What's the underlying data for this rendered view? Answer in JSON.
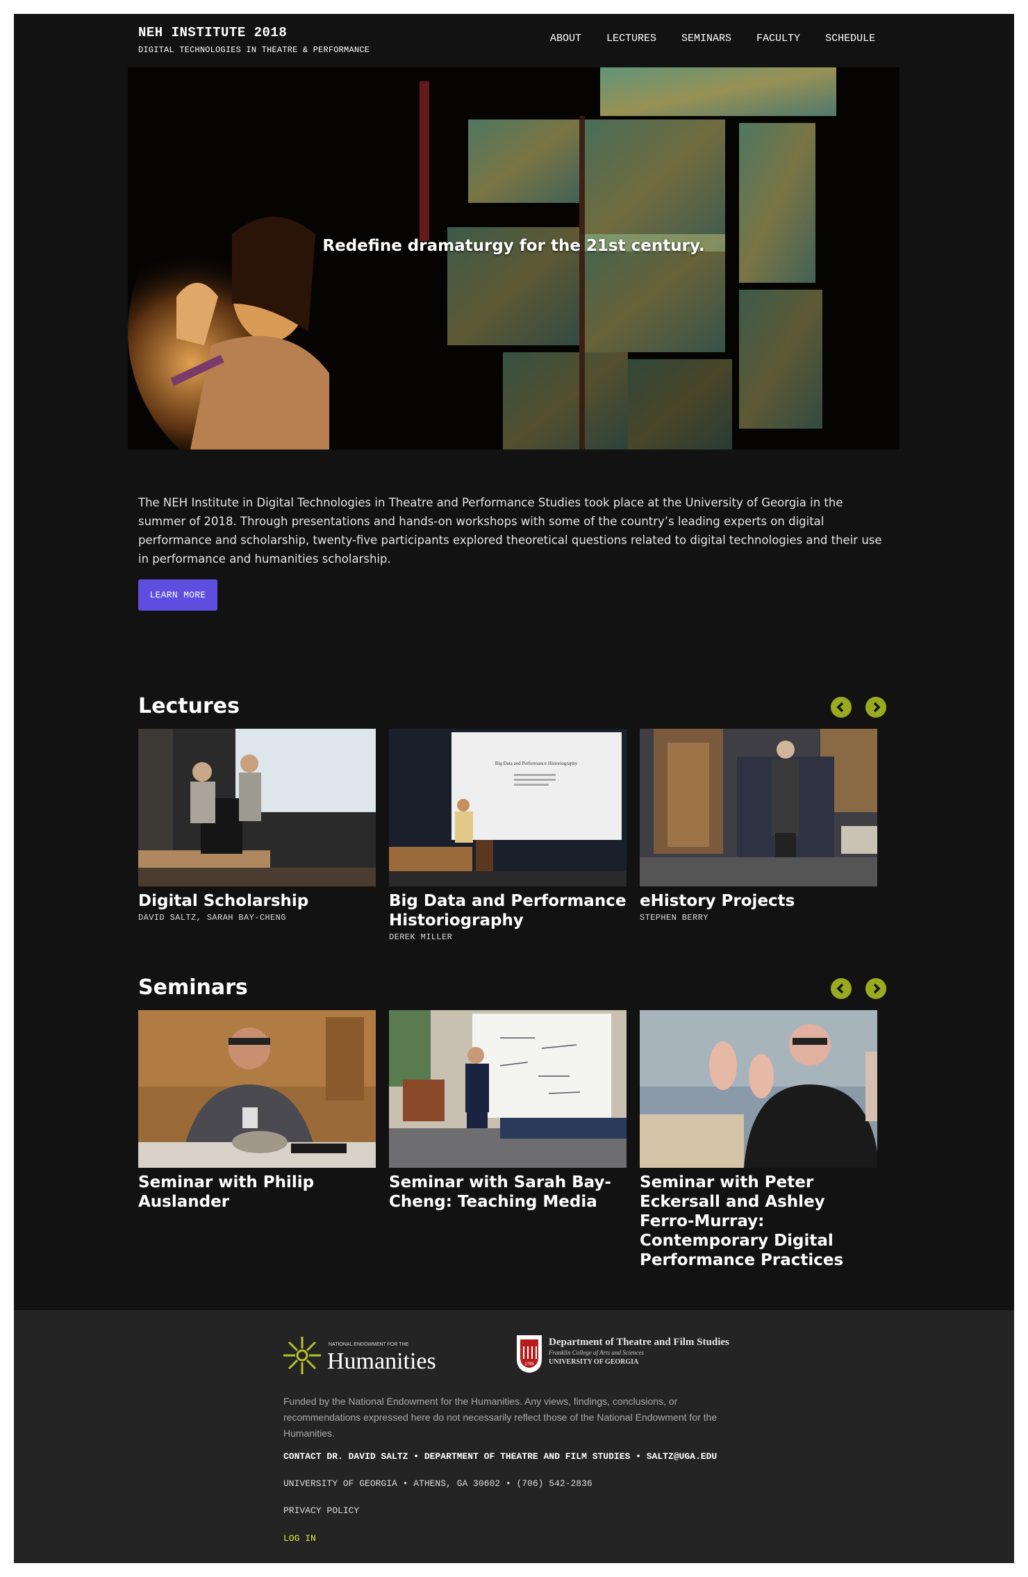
{
  "site": {
    "title": "NEH INSTITUTE 2018",
    "subtitle": "DIGITAL TECHNOLOGIES IN THEATRE & PERFORMANCE"
  },
  "nav": [
    "ABOUT",
    "LECTURES",
    "SEMINARS",
    "FACULTY",
    "SCHEDULE"
  ],
  "hero": {
    "tagline": "Redefine dramaturgy for the 21st century."
  },
  "intro": {
    "text": "The NEH Institute in Digital Technologies in Theatre and Performance Studies took place at the University of Georgia in the summer of 2018. Through presentations and hands-on workshops with some of the country’s leading experts on digital performance and scholarship, twenty-five participants explored theoretical questions related to digital technologies and their use in performance and humanities scholarship.",
    "button": "LEARN MORE"
  },
  "lectures": {
    "title": "Lectures",
    "items": [
      {
        "title": "Digital Scholarship",
        "speakers": "DAVID SALTZ, SARAH BAY-CHENG"
      },
      {
        "title": "Big Data and Performance Historiography",
        "speakers": "DEREK MILLER",
        "slide_title": "Big Data and Performance Historiography"
      },
      {
        "title": "eHistory Projects",
        "speakers": "STEPHEN BERRY"
      }
    ]
  },
  "seminars": {
    "title": "Seminars",
    "items": [
      {
        "title": "Seminar with Philip Auslander"
      },
      {
        "title": "Seminar with Sarah Bay-Cheng: Teaching Media"
      },
      {
        "title": "Seminar with Peter Eckersall and Ashley Ferro-Murray: Contemporary Digital Performance Practices"
      }
    ]
  },
  "footer": {
    "neh_small": "NATIONAL ENDOWMENT FOR THE",
    "neh_big": "Humanities",
    "uga_dept": "Department of Theatre and Film Studies",
    "uga_college": "Franklin College of Arts and Sciences",
    "uga_univ": "UNIVERSITY OF GEORGIA",
    "uga_year": "1785",
    "funded": "Funded by the National Endowment for the Humanities. Any views, findings, conclusions, or recommendations expressed here do not necessarily reflect those of the National Endowment for the Humanities.",
    "contact_label": "CONTACT DR. DAVID SALTZ",
    "dept": "DEPARTMENT OF THEATRE AND FILM STUDIES",
    "email": "SALTZ@UGA.EDU",
    "address": "UNIVERSITY OF GEORGIA • ATHENS, GA 30602 • (706) 542-2836",
    "privacy": "PRIVACY POLICY",
    "login": "LOG IN"
  },
  "colors": {
    "accent_button": "#5d4ee0",
    "arrow": "#9aaa1e",
    "login": "#e5ef3a"
  }
}
